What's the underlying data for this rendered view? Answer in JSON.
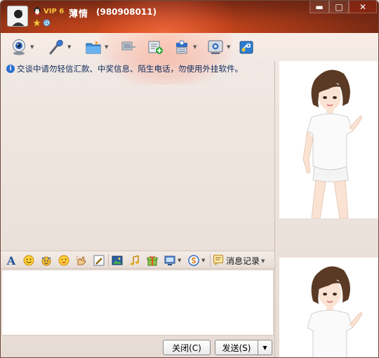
{
  "header": {
    "vip_label": "VIP 6",
    "nickname": "薄情",
    "qq_number": "(980908011)"
  },
  "window_controls": {
    "minimize": "▬",
    "maximize": "□",
    "close": "✕"
  },
  "toolbar": {
    "items": [
      {
        "name": "video-call",
        "icon": "webcam-icon"
      },
      {
        "name": "voice-call",
        "icon": "microphone-icon"
      },
      {
        "name": "send-file",
        "icon": "folder-icon"
      },
      {
        "name": "remote-assist",
        "icon": "remote-icon"
      },
      {
        "name": "send-sms",
        "icon": "sms-icon"
      },
      {
        "name": "create-group",
        "icon": "group-icon"
      },
      {
        "name": "apps",
        "icon": "apps-icon"
      },
      {
        "name": "share",
        "icon": "share-icon"
      }
    ]
  },
  "notice": {
    "text": "交谈中请勿轻信汇款、中奖信息、陌生电话，勿使用外挂软件。"
  },
  "format_bar": {
    "font_glyph": "A",
    "message_log_label": "消息记录"
  },
  "buttons": {
    "close_label": "关闭(C)",
    "send_label": "发送(S)"
  },
  "colors": {
    "header_dark": "#5a2010",
    "header_accent": "#d9531c",
    "vip_gold": "#f8c23a",
    "notice_text": "#0e2a5a"
  }
}
